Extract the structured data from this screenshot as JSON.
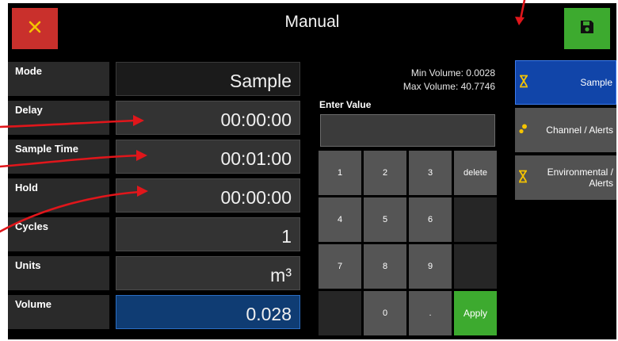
{
  "header": {
    "title": "Manual"
  },
  "icons": {
    "close": "close-icon",
    "save": "save-icon",
    "hourglass": "hourglass-icon",
    "channel": "channel-alerts-icon"
  },
  "colors": {
    "close_bg": "#c9302c",
    "save_bg": "#3daa2f",
    "active_tab": "#1145a9",
    "volume_field": "#0f3c73",
    "annotation_arrow": "#e0161b"
  },
  "form": {
    "rows": [
      {
        "label": "Mode",
        "value": "Sample"
      },
      {
        "label": "Delay",
        "value": "00:00:00"
      },
      {
        "label": "Sample Time",
        "value": "00:01:00"
      },
      {
        "label": "Hold",
        "value": "00:00:00"
      },
      {
        "label": "Cycles",
        "value": "1"
      },
      {
        "label": "Units",
        "value": "m³"
      },
      {
        "label": "Volume",
        "value": "0.028"
      }
    ]
  },
  "volume_limits": {
    "min": "Min Volume: 0.0028",
    "max": "Max Volume: 40.7746"
  },
  "keypad": {
    "label": "Enter Value",
    "value": "",
    "keys": [
      "1",
      "2",
      "3",
      "delete",
      "4",
      "5",
      "6",
      "7",
      "8",
      "9",
      "0",
      ".",
      "Apply"
    ]
  },
  "tabs": [
    {
      "label": "Sample",
      "active": true
    },
    {
      "label": "Channel / Alerts",
      "active": false
    },
    {
      "label": "Environmental / Alerts",
      "active": false
    }
  ]
}
